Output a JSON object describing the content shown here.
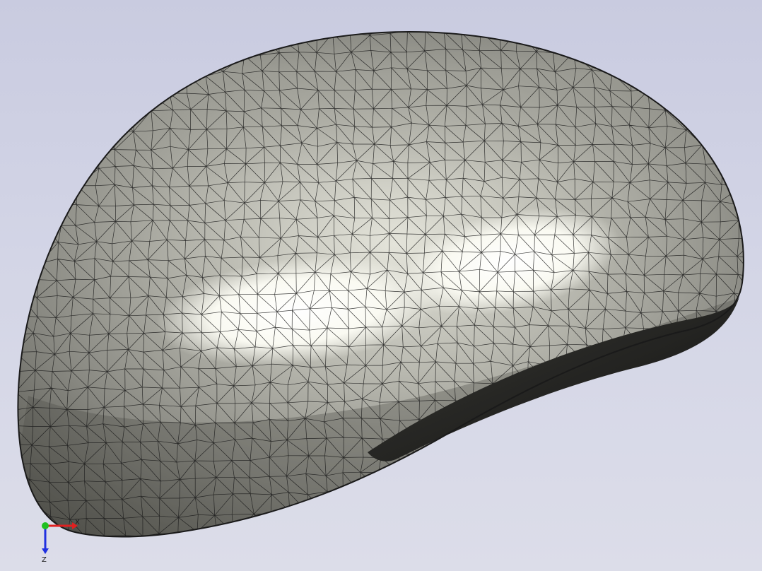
{
  "viewport": {
    "background_top": "#c9cbe0",
    "background_bottom": "#dcdde9"
  },
  "model": {
    "shape": "helmet-shell-mesh",
    "display_mode": "shaded-with-edges",
    "base_color": "#8f8f88",
    "highlight_color": "#ffffff",
    "edge_color": "#1a1a1a"
  },
  "triad": {
    "x_label": "X",
    "z_label": "Z",
    "x_color": "#e02020",
    "y_color": "#20c020",
    "z_color": "#2030e0"
  }
}
